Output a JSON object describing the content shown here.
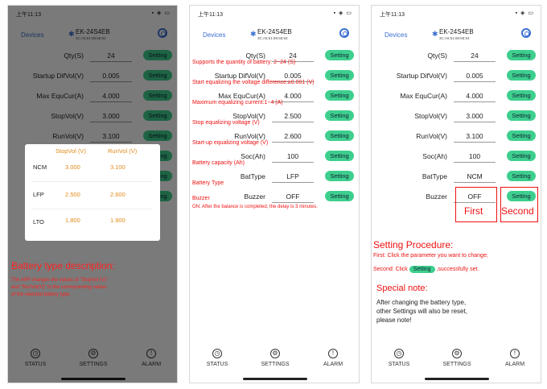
{
  "status_bar": {
    "time": "上午11:13",
    "icons": "▪ ◈ ▭"
  },
  "header": {
    "devices": "Devices",
    "device_name": "EK-24S4EB",
    "device_mac": "3C:A5:51:88:68:93"
  },
  "rows": [
    {
      "label": "Qty(S)",
      "value": "24",
      "button": "Setting"
    },
    {
      "label": "Startup DifVol(V)",
      "value": "0.005",
      "button": "Setting"
    },
    {
      "label": "Max EquCur(A)",
      "value": "4.000",
      "button": "Setting"
    },
    {
      "label": "StopVol(V)",
      "value": "3.000",
      "button": "Setting"
    },
    {
      "label": "RunVol(V)",
      "value": "3.100",
      "button": "Setting"
    },
    {
      "label": "Soc(Ah)",
      "value": "100",
      "button": "Setting"
    },
    {
      "label": "BatType",
      "value": "NCM",
      "button": "Setting"
    },
    {
      "label": "Buzzer",
      "value": "OFF",
      "button": "Setting"
    }
  ],
  "phone2_values": [
    "24",
    "0.005",
    "4.000",
    "2.500",
    "2.600",
    "100",
    "LFP",
    "OFF"
  ],
  "nav": {
    "status": "STATUS",
    "settings": "SETTINGS",
    "alarm": "ALARM"
  },
  "popup": {
    "col1": "StopVol (V)",
    "col2": "RunVol (V)",
    "types": [
      {
        "name": "NCM",
        "stop": "3.000",
        "run": "3.100"
      },
      {
        "name": "LFP",
        "stop": "2.500",
        "run": "2.600"
      },
      {
        "name": "LTO",
        "stop": "1.800",
        "run": "1.900"
      }
    ]
  },
  "phone1_desc": {
    "title": "Battery type description:",
    "body1": "The APP changes the values of \"StopVol (V)\"",
    "body2": "and \"RunVol(V)\" to the corresponding values",
    "body3": "of the selected battery type."
  },
  "phone2_notes": [
    "Supports the quantity of battery: 2~24 (S)",
    "Start equalizing the voltage difference:≥0.001 (V)",
    "Maximum equalizing current:1~4  (A)",
    "Stop equalizing voltage (V)",
    "Start-up equalizing voltage (V)",
    "Battery capacity (Ah)",
    "Battery Type",
    "Buzzer"
  ],
  "phone2_on": "ON: After the balance is completed, the delay is 3 minutes.",
  "phone3": {
    "first": "First",
    "second": "Second",
    "proc_title": "Setting  Procedure:",
    "proc_1": "First: Click the parameter you want to change;",
    "proc_2a": "Second: Click ",
    "proc_btn": "Setting",
    "proc_2b": " ,successfully set.",
    "note_title": "Special note:",
    "note_1": "After changing the battery type,",
    "note_2": "other Settings will also be reset,",
    "note_3": "please note!"
  }
}
